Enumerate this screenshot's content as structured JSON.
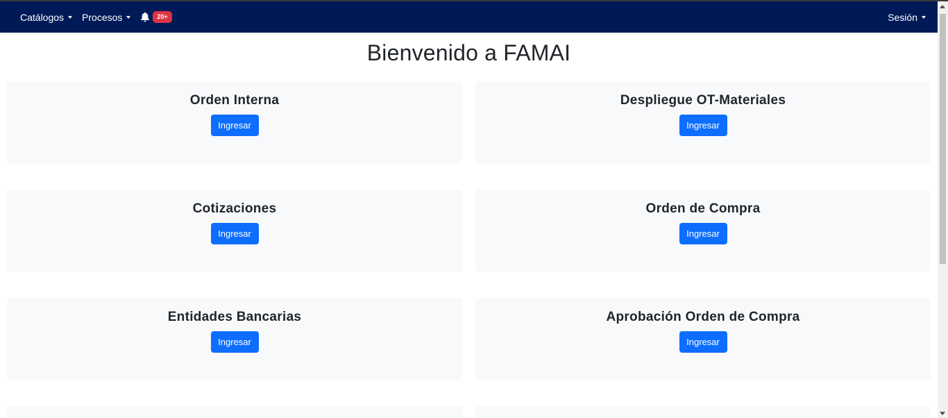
{
  "navbar": {
    "catalogs_label": "Catálogos",
    "processes_label": "Procesos",
    "notifications_badge": "20+",
    "session_label": "Sesión"
  },
  "main": {
    "title": "Bienvenido a FAMAI",
    "cards": [
      {
        "title": "Orden Interna",
        "button_label": "Ingresar"
      },
      {
        "title": "Despliegue OT-Materiales",
        "button_label": "Ingresar"
      },
      {
        "title": "Cotizaciones",
        "button_label": "Ingresar"
      },
      {
        "title": "Orden de Compra",
        "button_label": "Ingresar"
      },
      {
        "title": "Entidades Bancarias",
        "button_label": "Ingresar"
      },
      {
        "title": "Aprobación Orden de Compra",
        "button_label": "Ingresar"
      }
    ]
  },
  "colors": {
    "navbar_bg": "#001a57",
    "card_bg": "#f8f9fa",
    "primary_button": "#0d6efd",
    "badge": "#dc3545"
  },
  "icons": {
    "notifications": "bell-icon",
    "dropdown": "caret-down-icon"
  }
}
